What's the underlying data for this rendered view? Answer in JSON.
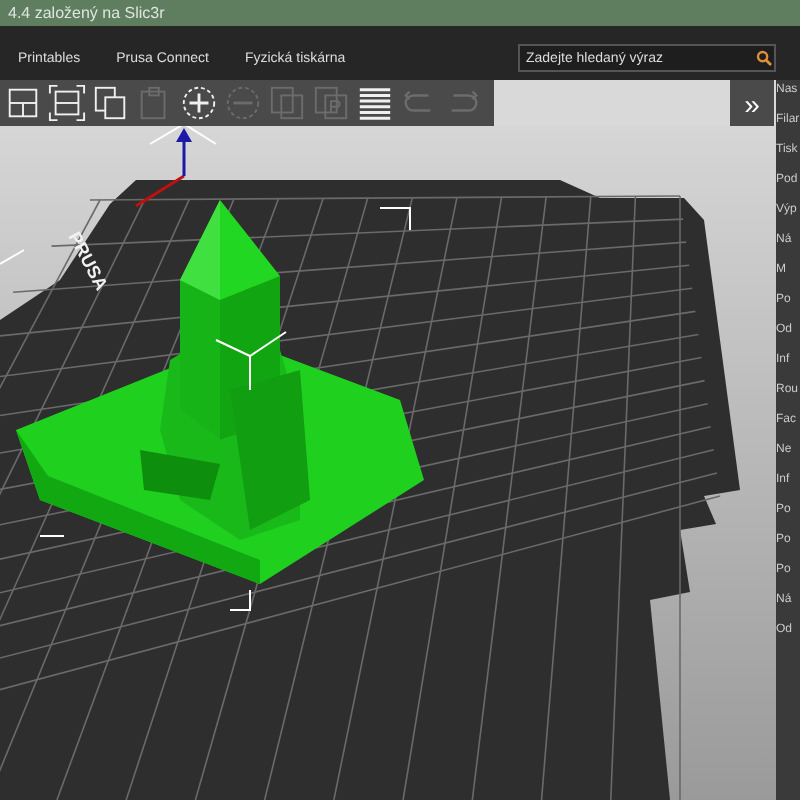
{
  "window": {
    "title": "4.4 založený na Slic3r"
  },
  "tabs": [
    {
      "label": "Printables",
      "selected": false
    },
    {
      "label": "Prusa Connect",
      "selected": false
    },
    {
      "label": "Fyzická tiskárna",
      "selected": false
    }
  ],
  "search": {
    "placeholder": "Zadejte hledaný výraz"
  },
  "toolbar": [
    {
      "kind": "arrange",
      "disabled": false
    },
    {
      "kind": "arrange-selection",
      "disabled": false
    },
    {
      "kind": "copy",
      "disabled": false
    },
    {
      "kind": "paste",
      "disabled": true
    },
    {
      "kind": "add",
      "disabled": false
    },
    {
      "kind": "remove",
      "disabled": true
    },
    {
      "kind": "instances",
      "disabled": true
    },
    {
      "kind": "parts",
      "disabled": true
    },
    {
      "kind": "layers",
      "disabled": false
    },
    {
      "kind": "undo",
      "disabled": true
    },
    {
      "kind": "redo",
      "disabled": true
    }
  ],
  "collapse_button": {
    "label": "»"
  },
  "bed": {
    "label": "PRUSA"
  },
  "sidebar": {
    "labels": [
      "Nas",
      "Filar",
      "Tisk",
      "Pod",
      "Výp",
      "Ná",
      "M",
      "Po",
      "Od",
      "Inf",
      "Rou",
      "Fac",
      "Ne",
      "Inf",
      "Po",
      "Po",
      "Po",
      "Ná",
      "Od"
    ]
  }
}
